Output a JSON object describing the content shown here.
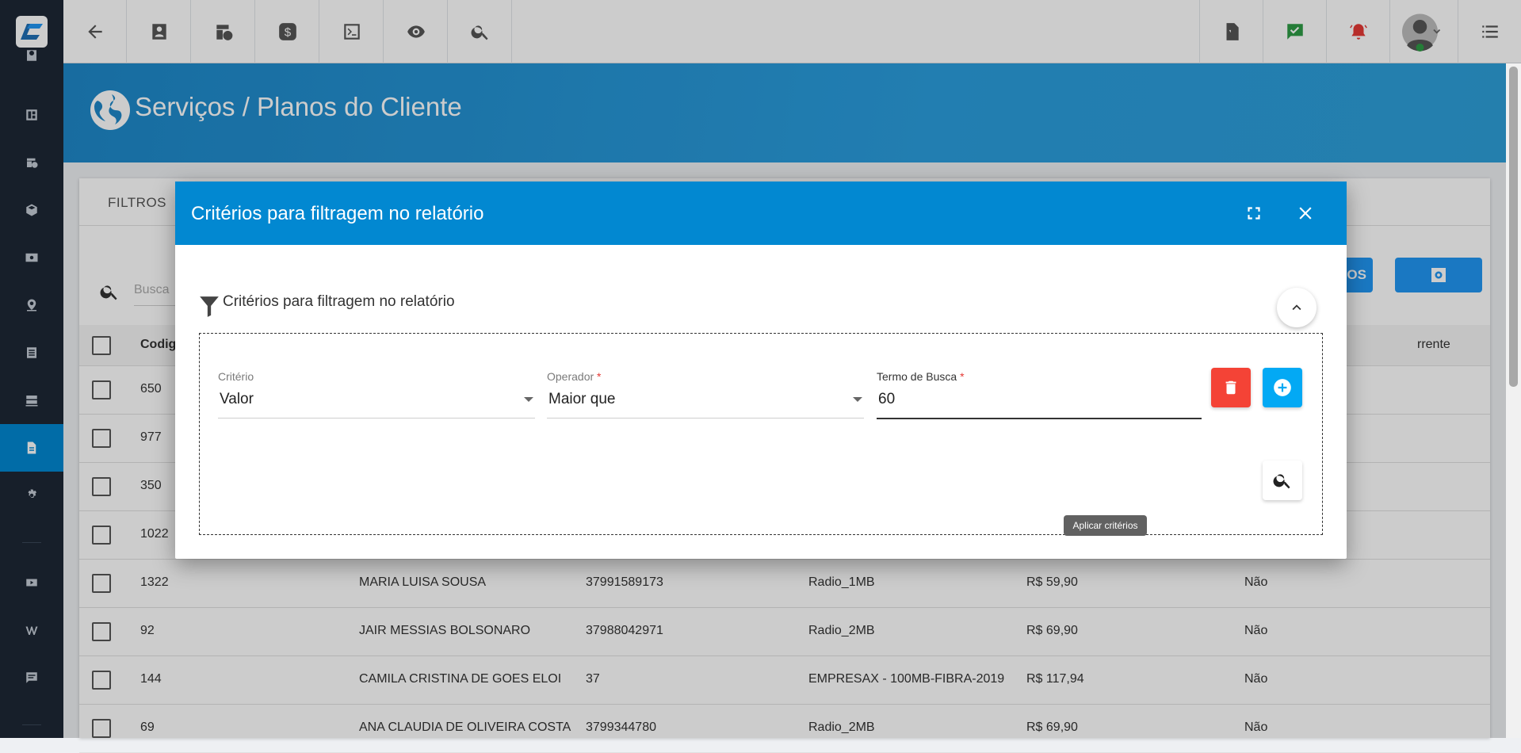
{
  "page": {
    "title": "Serviços / Planos do Cliente"
  },
  "topbar": {
    "icons": [
      "back-arrow-icon",
      "contact-card-icon",
      "calendar-clock-icon",
      "dollar-icon",
      "terminal-icon",
      "eye-icon",
      "search-icon",
      "pdf-icon",
      "task-check-icon",
      "alarm-bell-icon",
      "user-avatar-icon",
      "list-menu-icon"
    ],
    "colors": {
      "check": "#2e9c45",
      "bell": "#e53935"
    }
  },
  "sidebar": {
    "active_index": 8,
    "icons": [
      "contact-icon",
      "dashboard-icon",
      "calendar-icon",
      "box-icon",
      "money-icon",
      "location-icon",
      "list-icon",
      "server-icon",
      "document-icon",
      "gear-icon",
      "youtube-icon",
      "wiki-icon",
      "chat-icon"
    ]
  },
  "card": {
    "tab": "FILTROS",
    "search_placeholder": "Busca",
    "button_partial_label": "IOS",
    "columns": [
      "Codig",
      "rrente"
    ],
    "rows": [
      {
        "code": "650",
        "name": "",
        "phone": "",
        "plan": "",
        "value": "",
        "flag": ""
      },
      {
        "code": "977",
        "name": "",
        "phone": "",
        "plan": "",
        "value": "",
        "flag": ""
      },
      {
        "code": "350",
        "name": "",
        "phone": "",
        "plan": "",
        "value": "",
        "flag": ""
      },
      {
        "code": "1022",
        "name": "",
        "phone": "",
        "plan": "",
        "value": "",
        "flag": ""
      },
      {
        "code": "1322",
        "name": "MARIA LUISA SOUSA",
        "phone": "37991589173",
        "plan": "Radio_1MB",
        "value": "R$ 59,90",
        "flag": "Não"
      },
      {
        "code": "92",
        "name": "JAIR MESSIAS BOLSONARO",
        "phone": "37988042971",
        "plan": "Radio_2MB",
        "value": "R$ 69,90",
        "flag": "Não"
      },
      {
        "code": "144",
        "name": "CAMILA CRISTINA DE GOES ELOI",
        "phone": "37",
        "plan": "EMPRESAX - 100MB-FIBRA-2019",
        "value": "R$ 117,94",
        "flag": "Não"
      },
      {
        "code": "69",
        "name": "ANA CLAUDIA DE OLIVEIRA COSTA",
        "phone": "3799344780",
        "plan": "Radio_2MB",
        "value": "R$ 69,90",
        "flag": "Não"
      }
    ]
  },
  "modal": {
    "title": "Critérios para filtragem no relatório",
    "section_title": "Critérios para filtragem no relatório",
    "fields": {
      "criterio": {
        "label": "Critério",
        "value": "Valor"
      },
      "operador": {
        "label": "Operador",
        "value": "Maior que",
        "required": "*"
      },
      "termo": {
        "label": "Termo de Busca",
        "value": "60",
        "required": "*"
      }
    },
    "tooltip": "Aplicar critérios",
    "colors": {
      "header": "#0288d1",
      "delete": "#f44336",
      "add": "#03a9f4"
    }
  }
}
